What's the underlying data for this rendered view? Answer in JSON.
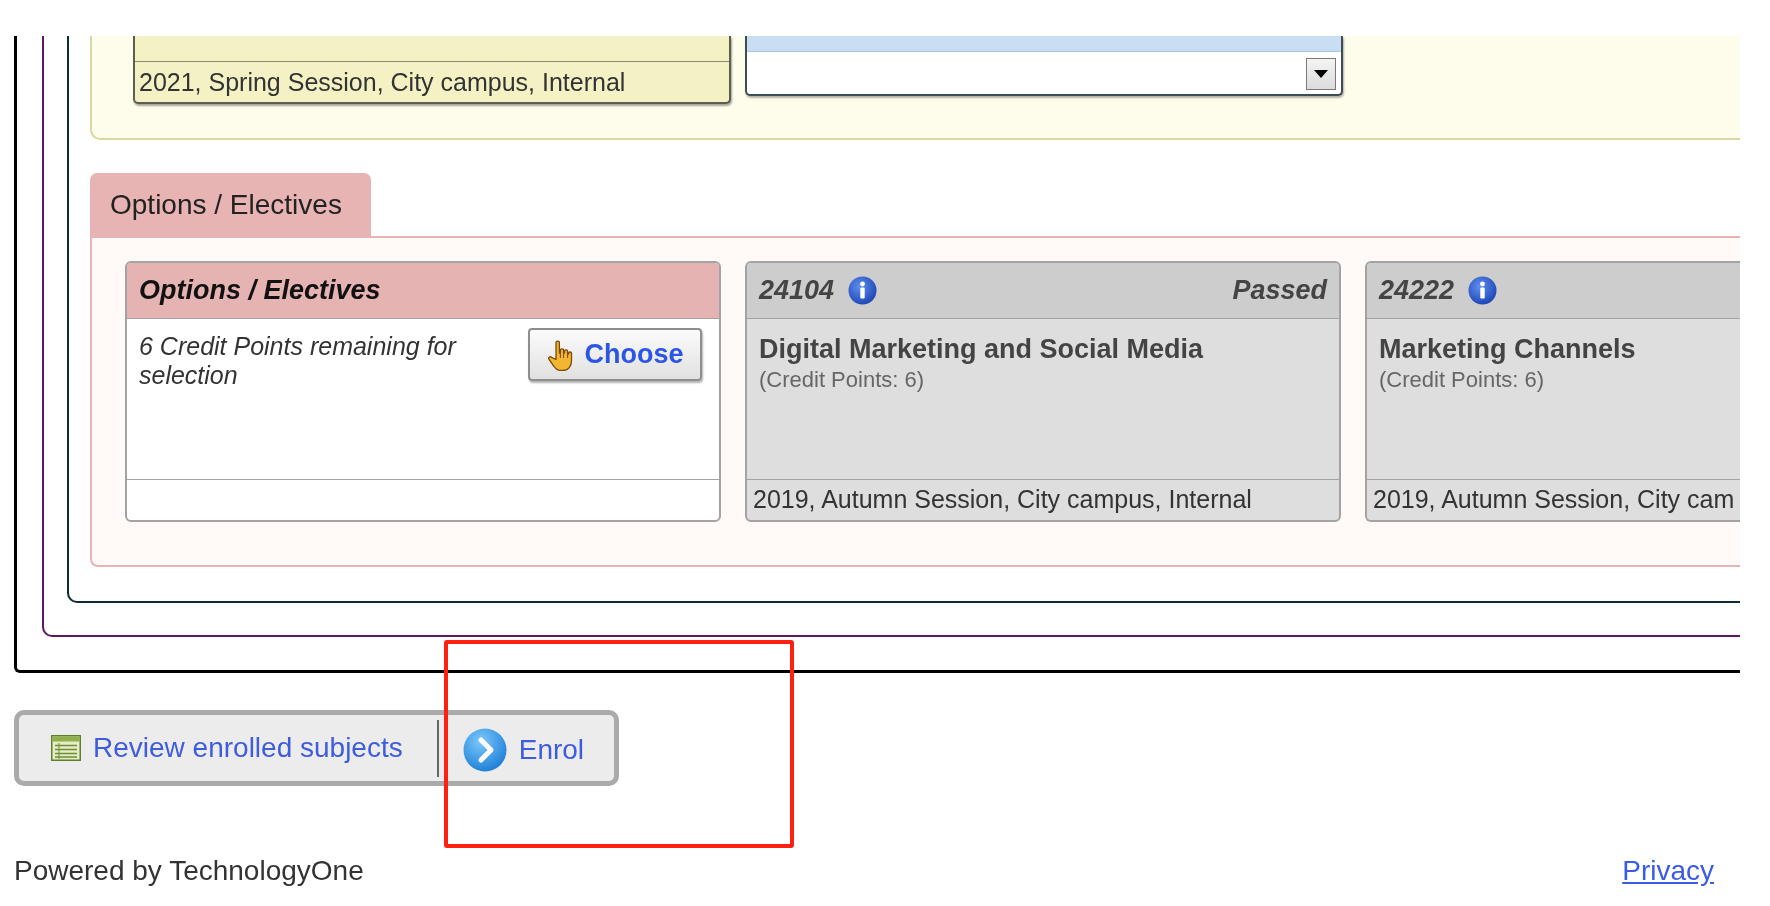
{
  "top_section": {
    "card": {
      "footer": "2021, Spring Session, City campus, Internal"
    }
  },
  "section_tab": {
    "label": "Options / Electives"
  },
  "cards": [
    {
      "kind": "elective",
      "title": "Options / Electives",
      "note": "6 Credit Points remaining for selection",
      "button": "Choose"
    },
    {
      "kind": "subject",
      "code": "24104",
      "status": "Passed",
      "name": "Digital Marketing and Social Media",
      "credit": "(Credit Points: 6)",
      "footer": "2019, Autumn Session, City campus, Internal"
    },
    {
      "kind": "subject",
      "code": "24222",
      "name": "Marketing Channels",
      "credit": "(Credit Points: 6)",
      "footer": "2019, Autumn Session, City cam"
    }
  ],
  "actions": [
    {
      "kind": "review",
      "label": "Review enrolled subjects"
    },
    {
      "kind": "enrol",
      "label": "Enrol"
    }
  ],
  "footer": {
    "credit": "Powered by TechnologyOne",
    "privacy_link": "Privacy"
  }
}
